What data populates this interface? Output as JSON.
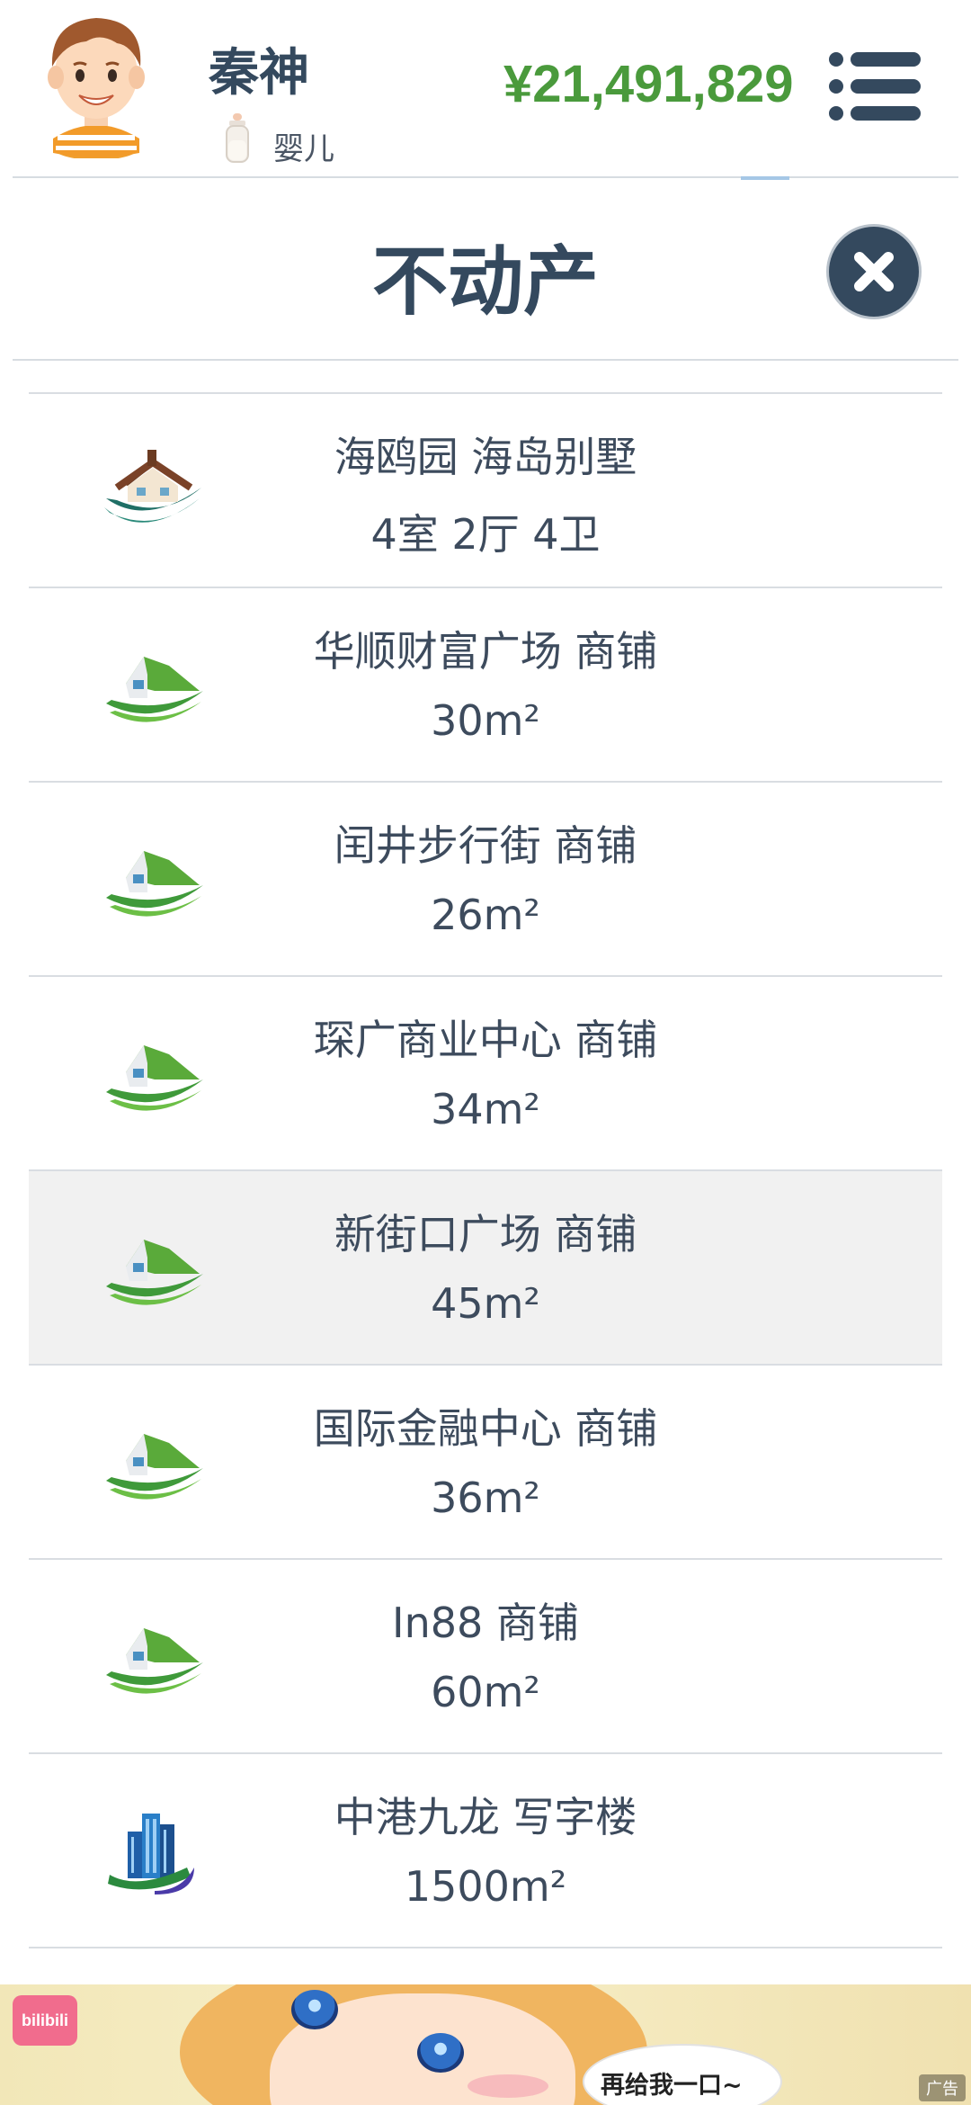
{
  "header": {
    "player_name": "秦神",
    "life_stage": "婴儿",
    "money": "¥21,491,829"
  },
  "page": {
    "title": "不动产"
  },
  "properties": [
    {
      "name": "海鸥园 海岛别墅",
      "size": "4室 2厅 4卫",
      "icon": "villa-icon"
    },
    {
      "name": "华顺财富广场 商铺",
      "size": "30m²",
      "icon": "shop-icon"
    },
    {
      "name": "闰井步行街 商铺",
      "size": "26m²",
      "icon": "shop-icon"
    },
    {
      "name": "琛广商业中心 商铺",
      "size": "34m²",
      "icon": "shop-icon"
    },
    {
      "name": "新街口广场 商铺",
      "size": "45m²",
      "icon": "shop-icon",
      "selected": true
    },
    {
      "name": "国际金融中心 商铺",
      "size": "36m²",
      "icon": "shop-icon"
    },
    {
      "name": "In88 商铺",
      "size": "60m²",
      "icon": "shop-icon"
    },
    {
      "name": "中港九龙 写字楼",
      "size": "1500m²",
      "icon": "office-building-icon"
    }
  ],
  "ad": {
    "logo": "bilibili",
    "caption": "再给我一口~",
    "tag": "广告"
  },
  "colors": {
    "primary": "#34495e",
    "money": "#4a9a3c",
    "divider": "#d9dde2",
    "selected_row": "#f1f1f1"
  }
}
